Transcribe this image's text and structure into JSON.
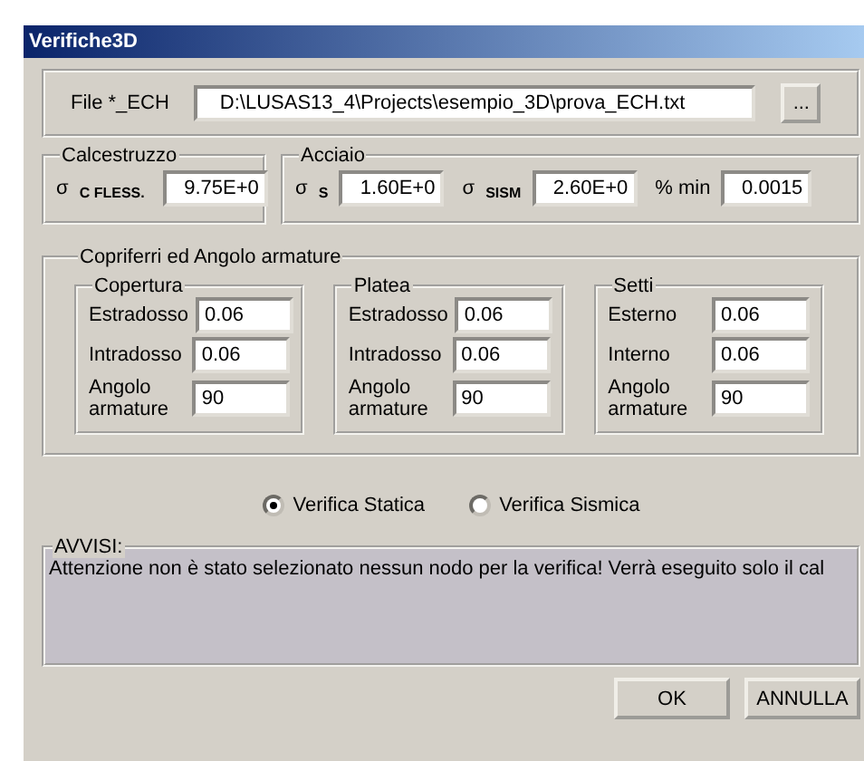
{
  "window": {
    "title": "Verifiche3D"
  },
  "file": {
    "label": "File *_ECH",
    "value": "D:\\LUSAS13_4\\Projects\\esempio_3D\\prova_ECH.txt",
    "browse": "..."
  },
  "calcestruzzo": {
    "title": "Calcestruzzo",
    "fields": [
      {
        "label": "σ $_{C FLESS.}$",
        "value": "9.75E+0"
      }
    ]
  },
  "acciaio": {
    "title": "Acciaio",
    "fields": [
      {
        "label": "σ $_{S}$",
        "value": "1.60E+0"
      },
      {
        "label": "σ $_{SISM}$",
        "value": "2.60E+0"
      },
      {
        "label": "% min",
        "value": "0.0015"
      }
    ]
  },
  "copriferri": {
    "title": "Copriferri ed Angolo armature",
    "groups": [
      {
        "title": "Copertura",
        "fields": [
          {
            "label": "Estradosso",
            "value": "0.06"
          },
          {
            "label": "Intradosso",
            "value": "0.06"
          },
          {
            "label": "Angolo armature",
            "value": "90"
          }
        ]
      },
      {
        "title": "Platea",
        "fields": [
          {
            "label": "Estradosso",
            "value": "0.06"
          },
          {
            "label": "Intradosso",
            "value": "0.06"
          },
          {
            "label": "Angolo armature",
            "value": "90"
          }
        ]
      },
      {
        "title": "Setti",
        "fields": [
          {
            "label": "Esterno",
            "value": "0.06"
          },
          {
            "label": "Interno",
            "value": "0.06"
          },
          {
            "label": "Angolo armature",
            "value": "90"
          }
        ]
      }
    ]
  },
  "verifica": [
    {
      "label": "Verifica Statica",
      "selected": true
    },
    {
      "label": "Verifica Sismica",
      "selected": false
    }
  ],
  "avvisi": {
    "title": "AVVISI:",
    "message": "Attenzione non è stato selezionato nessun nodo per la verifica! Verrà eseguito solo il cal"
  },
  "buttons": [
    "OK",
    "ANNULLA"
  ]
}
